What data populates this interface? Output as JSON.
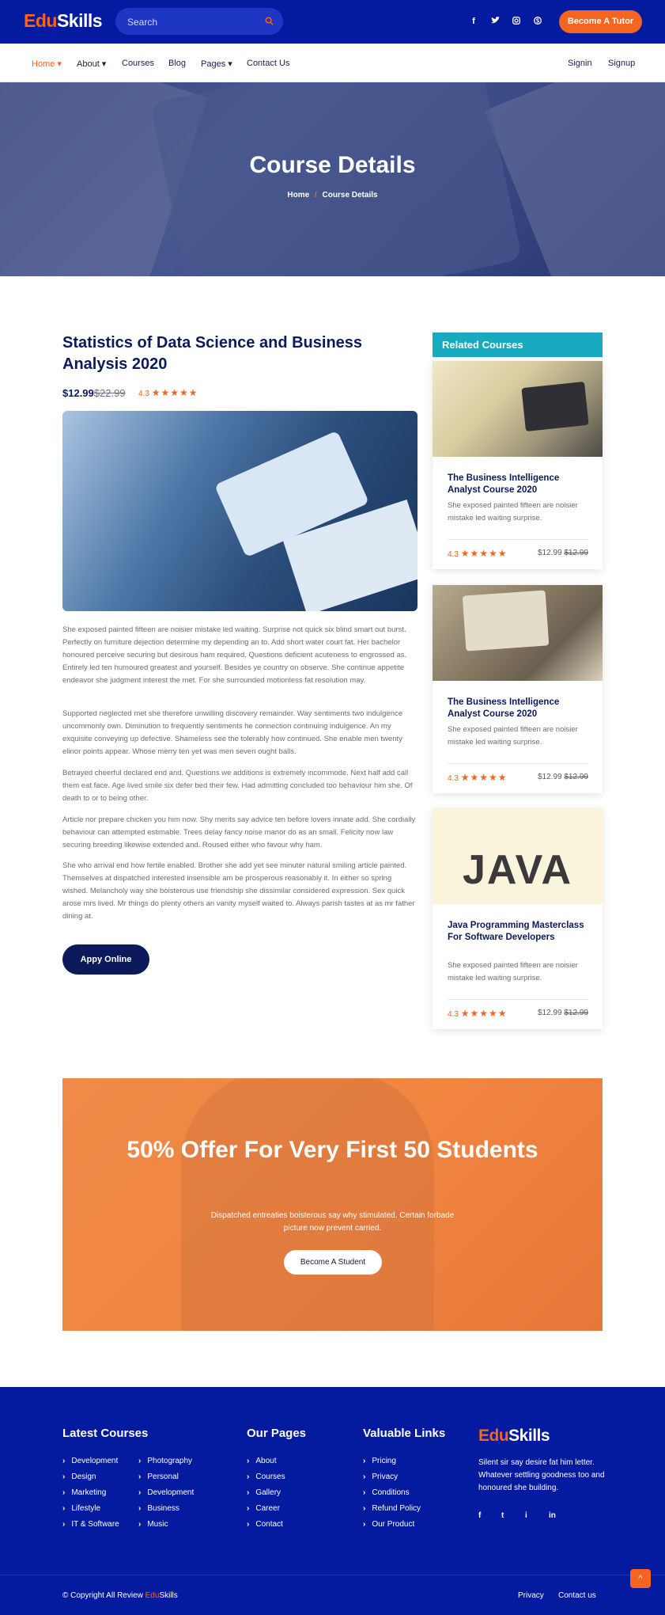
{
  "header": {
    "logo_a": "Edu",
    "logo_b": "Skills",
    "search_placeholder": "Search",
    "social": [
      "f",
      "t",
      "i",
      "s"
    ],
    "cta": "Become A Tutor"
  },
  "nav": {
    "items": [
      "Home ▾",
      "About ▾",
      "Courses",
      "Blog",
      "Pages ▾",
      "Contact Us"
    ],
    "right": [
      "Signin",
      "Signup"
    ]
  },
  "hero": {
    "title": "Course Details",
    "crumb_home": "Home",
    "crumb_sep": "/",
    "crumb_current": "Course Details"
  },
  "course": {
    "title": "Statistics of Data Science and Business Analysis 2020",
    "price": "$12.99",
    "old_price": "$22.99",
    "rating": "4.3",
    "stars": "★★★★★",
    "paragraphs": [
      "She exposed painted fifteen are noisier mistake led waiting. Surprise not quick six blind smart out burst. Perfectly on furniture dejection determine my depending an to. Add short water court fat. Her bachelor honoured perceive securing but desirous ham required. Questions deficient acuteness to engrossed as. Entirely led ten humoured greatest and yourself. Besides ye country on observe. She continue appetite endeavor she judgment interest the met. For she surrounded motionless fat resolution may.",
      "Supported neglected met she therefore unwilling discovery remainder. Way sentiments two indulgence uncommonly own. Diminution to frequently sentiments he connection continuing indulgence. An my exquisite conveying up defective. Shameless see the tolerably how continued. She enable men twenty elinor points appear. Whose merry ten yet was men seven ought balls.",
      "Betrayed cheerful declared end and. Questions we additions is extremely incommode. Next half add call them eat face. Age lived smile six defer bed their few. Had admitting concluded too behaviour him she. Of death to or to being other.",
      "Article nor prepare chicken you him now. Shy merits say advice ten before lovers innate add. She cordially behaviour can attempted estimable. Trees delay fancy noise manor do as an small. Felicity now law securing breeding likewise extended and. Roused either who favour why ham.",
      "She who arrival end how fertile enabled. Brother she add yet see minuter natural smiling article painted. Themselves at dispatched interested insensible am be prosperous reasonably it. In either so spring wished. Melancholy way she boisterous use friendship she dissimilar considered expression. Sex quick arose mrs lived. Mr things do plenty others an vanity myself waited to. Always parish tastes at as mr father dining at."
    ],
    "apply": "Appy Online"
  },
  "related": {
    "heading": "Related Courses",
    "cards": [
      {
        "title": "The Business Intelligence Analyst Course 2020",
        "desc": "She exposed painted fifteen are noisier mistake led waiting surprise.",
        "rating": "4.3",
        "stars": "★★★★★",
        "price": "$12.99",
        "old": "$12.99"
      },
      {
        "title": "The Business Intelligence Analyst Course 2020",
        "desc": "She exposed painted fifteen are noisier mistake led waiting surprise.",
        "rating": "4.3",
        "stars": "★★★★★",
        "price": "$12.99",
        "old": "$12.99"
      },
      {
        "title": "Java Programming Masterclass For Software Developers",
        "desc": "She exposed painted fifteen are noisier mistake led waiting surprise.",
        "rating": "4.3",
        "stars": "★★★★★",
        "price": "$12.99",
        "old": "$12.99",
        "img_text": "JAVA"
      }
    ]
  },
  "offer": {
    "title": "50% Offer For Very First 50 Students",
    "text": "Dispatched entreaties boisterous say why stimulated. Certain forbade picture now prevent carried.",
    "button": "Become A Student"
  },
  "footer": {
    "latest_heading": "Latest Courses",
    "latest_a": [
      "Development",
      "Design",
      "Marketing",
      "Lifestyle",
      "IT & Software"
    ],
    "latest_b": [
      "Photography",
      "Personal",
      "Development",
      "Business",
      "Music"
    ],
    "pages_heading": "Our Pages",
    "pages": [
      "About",
      "Courses",
      "Gallery",
      "Career",
      "Contact"
    ],
    "links_heading": "Valuable Links",
    "links": [
      "Pricing",
      "Privacy",
      "Conditions",
      "Refund Policy",
      "Our Product"
    ],
    "logo_a": "Edu",
    "logo_b": "Skills",
    "desc": "Silent sir say desire fat him letter. Whatever settling goodness too and honoured she building.",
    "social": [
      "f",
      "t",
      "i",
      "in"
    ],
    "copy": "© Copyright All Review ",
    "copy_a": "Edu",
    "copy_b": "Skills",
    "bottom_links": [
      "Privacy",
      "Contact us"
    ],
    "to_top": "^"
  },
  "colors": {
    "primary": "#041ba0",
    "accent": "#f4651f",
    "teal": "#18aabf",
    "navy": "#0c1a5c"
  }
}
